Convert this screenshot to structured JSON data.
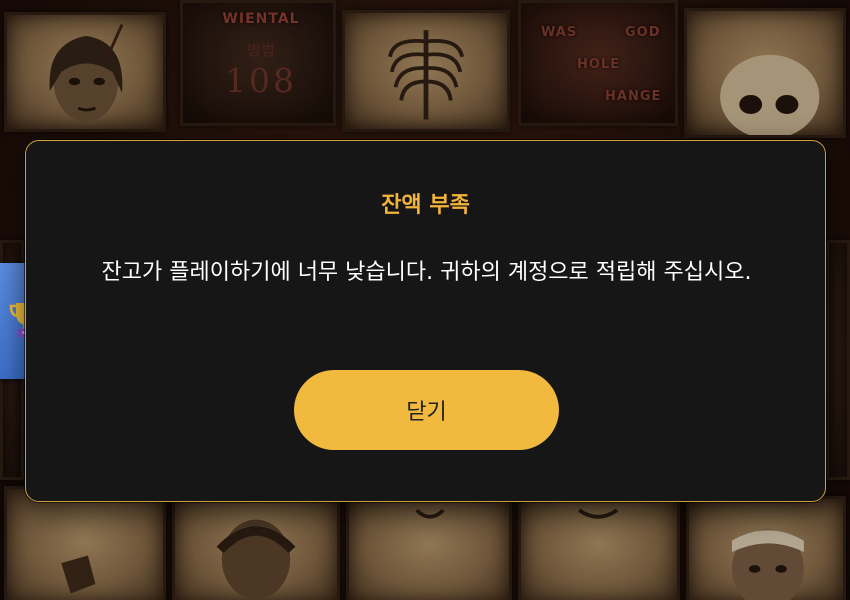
{
  "background": {
    "sign_top": "WIENTAL",
    "sign_mid": "방법",
    "sign_number": "108",
    "sign_words": [
      "WAS",
      "GOD",
      "HOLE",
      "HANGE"
    ]
  },
  "side_tab": {
    "icon": "trophy-icon",
    "color": "#4a7bd6"
  },
  "modal": {
    "title": "잔액 부족",
    "message": "잔고가 플레이하기에 너무 낮습니다. 귀하의 계정으로 적립해 주십시오.",
    "close_label": "닫기",
    "accent": "#f1b93e",
    "border": "#d0a03a",
    "background": "#161616"
  }
}
